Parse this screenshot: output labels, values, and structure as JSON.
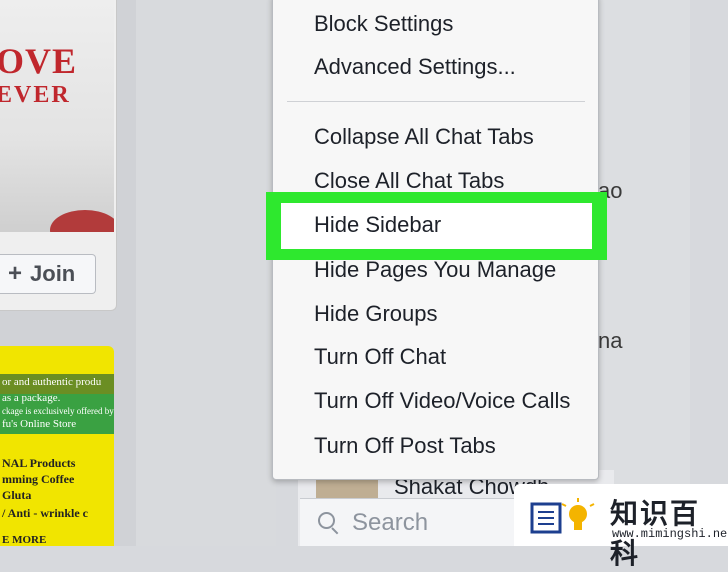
{
  "left_ads": {
    "ad1_line1": "OVE",
    "ad1_line2": "EVER",
    "join_label": "Join",
    "ad2_lines": [
      "or and authentic produ",
      "as a package.",
      "ckage is exclusively offered by",
      "fu's Online Store",
      "NAL Products",
      "mming Coffee",
      "Gluta",
      "/ Anti - wrinkle c",
      "E MORE"
    ]
  },
  "menu": {
    "items_top": [
      "Block Settings",
      "Advanced Settings..."
    ],
    "items_bottom": [
      "Collapse All Chat Tabs",
      "Close All Chat Tabs",
      "Hide Sidebar",
      "Hide Pages You Manage",
      "Hide Groups",
      "Turn Off Chat",
      "Turn Off Video/Voice Calls",
      "Turn Off Post Tabs"
    ],
    "highlighted": "Hide Sidebar"
  },
  "chat": {
    "fragment_1": "ao",
    "fragment_2": "na",
    "contact_name": "Shakat Chowdh",
    "search_placeholder": "Search"
  },
  "watermark": {
    "title": "知识百科",
    "url": "www.mimingshi.net"
  },
  "colors": {
    "highlight": "#2ee82e",
    "menu_bg": "#f7f7f7",
    "ad_red": "#c0272d",
    "ad_yellow": "#f1e500"
  }
}
